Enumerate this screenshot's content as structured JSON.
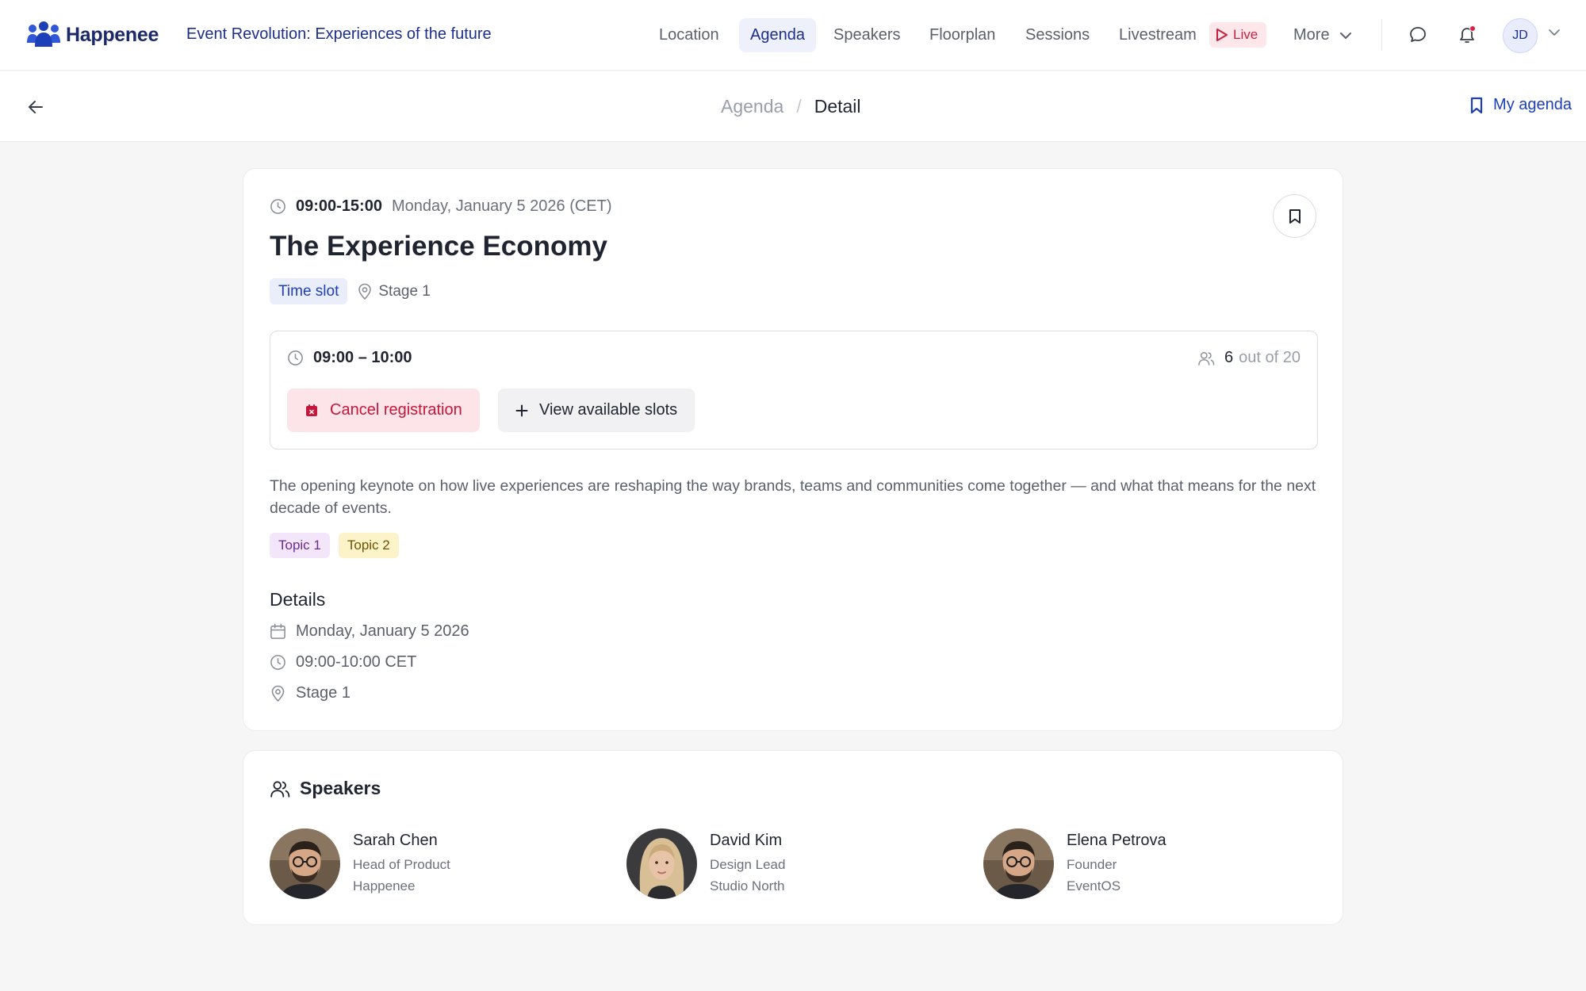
{
  "brand": {
    "name": "Happenee",
    "event_title": "Event Revolution: Experiences of the future"
  },
  "nav": {
    "items": [
      "Location",
      "Agenda",
      "Speakers",
      "Floorplan",
      "Sessions",
      "Livestream"
    ],
    "active": "Agenda",
    "live_label": "Live",
    "more_label": "More"
  },
  "user": {
    "initials": "JD"
  },
  "breadcrumb": {
    "parent": "Agenda",
    "separator": "/",
    "current": "Detail"
  },
  "my_agenda_label": "My agenda",
  "session": {
    "time_range": "09:00-15:00",
    "date_label": "Monday, January 5 2026 (CET)",
    "title": "The Experience Economy",
    "type_label": "Time slot",
    "location": "Stage 1",
    "slot": {
      "time": "09:00 – 10:00",
      "registered": "6",
      "capacity_text": "out of 20",
      "cancel_label": "Cancel registration",
      "view_slots_label": "View available slots"
    },
    "description": "The opening keynote on how live experiences are reshaping the way brands, teams and communities come together — and what that means for the next decade of events.",
    "topics": [
      "Topic 1",
      "Topic 2"
    ],
    "details_heading": "Details",
    "details": {
      "date": "Monday, January 5 2026",
      "time": "09:00-10:00 CET",
      "location": "Stage 1"
    }
  },
  "speakers": {
    "heading": "Speakers",
    "list": [
      {
        "name": "Sarah Chen",
        "role": "Head of Product",
        "org": "Happenee"
      },
      {
        "name": "David Kim",
        "role": "Design Lead",
        "org": "Studio North"
      },
      {
        "name": "Elena Petrova",
        "role": "Founder",
        "org": "EventOS"
      }
    ]
  },
  "colors": {
    "brand": "#1c2a6b",
    "accent": "#1d3fb8",
    "live": "#c7213f",
    "danger_bg": "#fde4e8"
  }
}
